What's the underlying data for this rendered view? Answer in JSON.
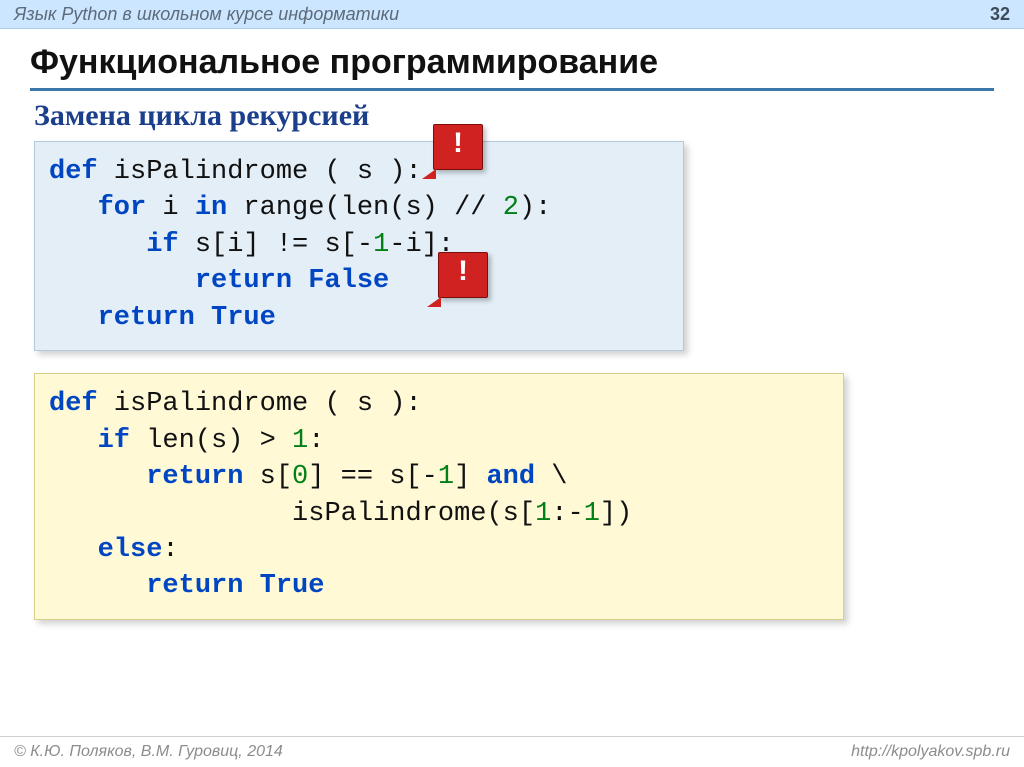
{
  "header": {
    "course": "Язык Python в школьном курсе информатики",
    "page": "32"
  },
  "title": "Функциональное программирование",
  "subtitle": "Замена цикла рекурсией",
  "callouts": {
    "mark": "!"
  },
  "code1": {
    "t0a": "def",
    "t0b": " isPalindrome ( s ):",
    "t1a": "   for",
    "t1b": " i ",
    "t1c": "in",
    "t1d": " range(len(s) // ",
    "t1e": "2",
    "t1f": "):",
    "t2a": "      if",
    "t2b": " s[i] != s[-",
    "t2c": "1",
    "t2d": "-i]:",
    "t3a": "         return",
    "t3b": " False",
    "t4a": "   return",
    "t4b": " True"
  },
  "code2": {
    "t0a": "def",
    "t0b": " isPalindrome ( s ):",
    "t1a": "   if",
    "t1b": " len(s) > ",
    "t1c": "1",
    "t1d": ":",
    "t2a": "      return",
    "t2b": " s[",
    "t2c": "0",
    "t2d": "] == s[-",
    "t2e": "1",
    "t2f": "] ",
    "t2g": "and",
    "t2h": " \\",
    "t3": "               isPalindrome(s[",
    "t3b": "1",
    "t3c": ":-",
    "t3d": "1",
    "t3e": "])",
    "t4a": "   else",
    "t4b": ":",
    "t5a": "      return",
    "t5b": " True"
  },
  "footer": {
    "left": "© К.Ю. Поляков, В.М. Гуровиц, 2014",
    "right": "http://kpolyakov.spb.ru"
  }
}
